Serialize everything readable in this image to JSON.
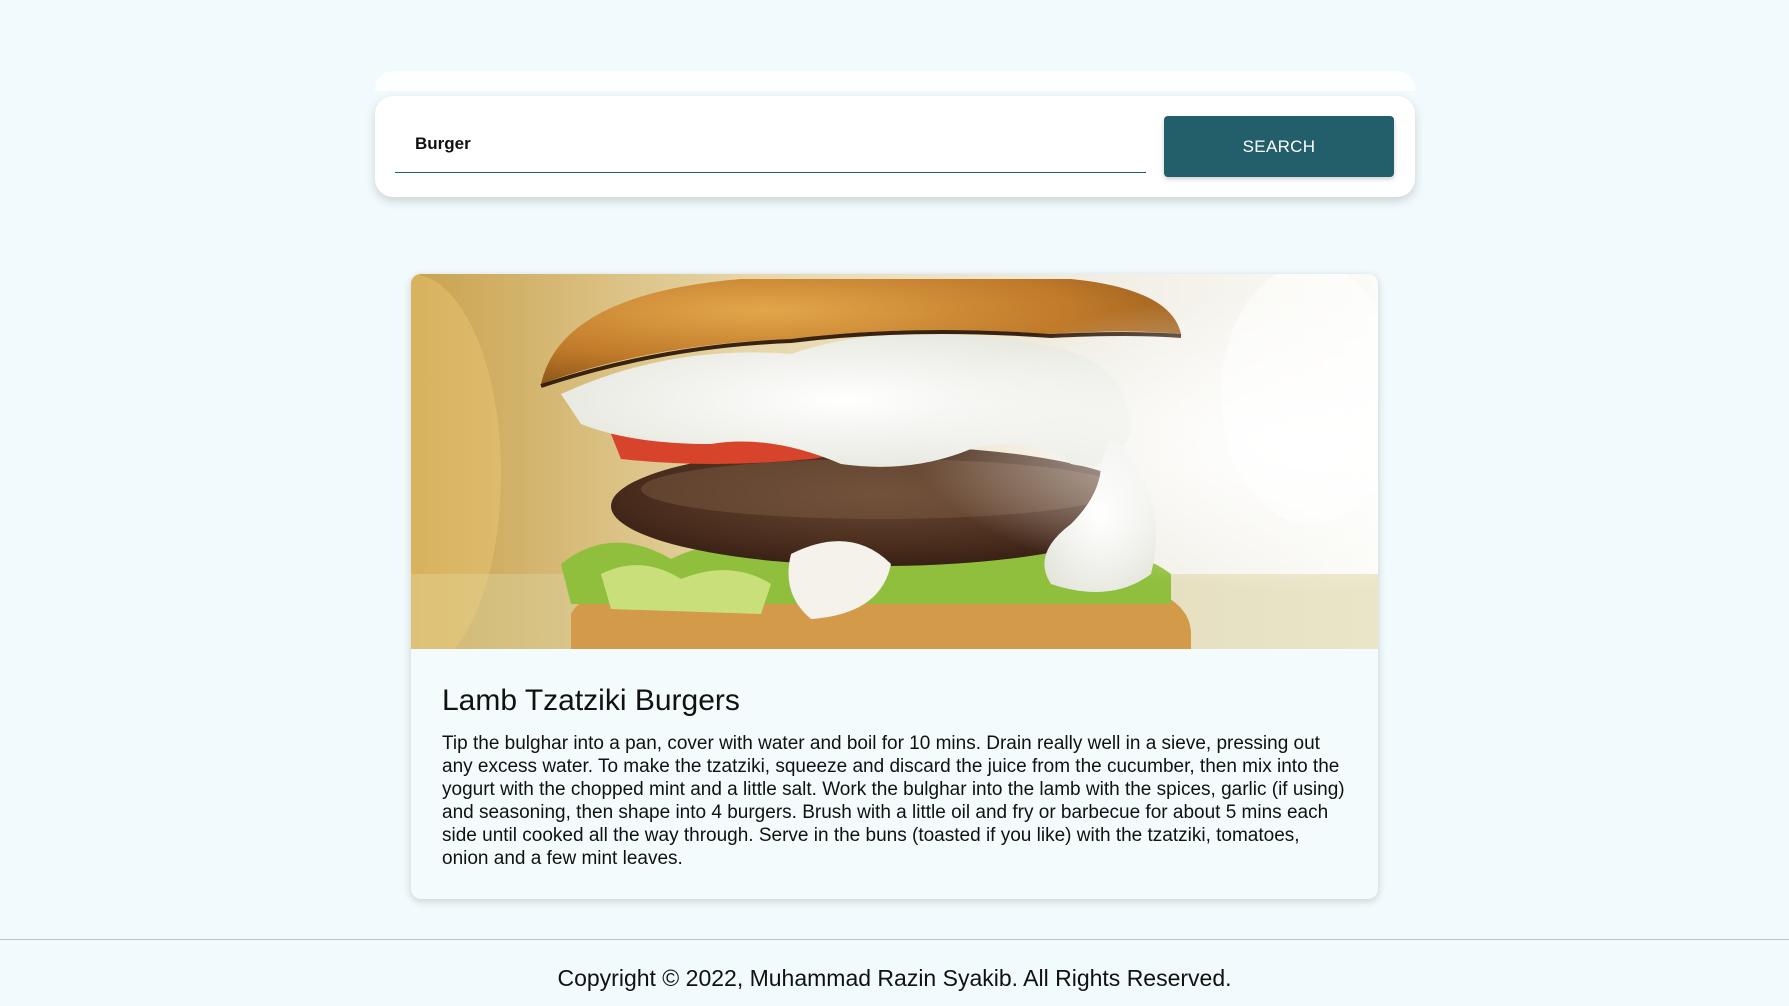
{
  "search": {
    "value": "Burger",
    "button_label": "SEARCH"
  },
  "recipe": {
    "title": "Lamb Tzatziki Burgers",
    "instructions": "Tip the bulghar into a pan, cover with water and boil for 10 mins. Drain really well in a sieve, pressing out any excess water. To make the tzatziki, squeeze and discard the juice from the cucumber, then mix into the yogurt with the chopped mint and a little salt. Work the bulghar into the lamb with the spices, garlic (if using) and seasoning, then shape into 4 burgers. Brush with a little oil and fry or barbecue for about 5 mins each side until cooked all the way through. Serve in the buns (toasted if you like) with the tzatziki, tomatoes, onion and a few mint leaves."
  },
  "footer": {
    "copyright": "Copyright © 2022, Muhammad Razin Syakib. All Rights Reserved."
  },
  "colors": {
    "page_background": "#f1fafc",
    "accent": "#235f6b",
    "card_background": "#f3fbfc"
  }
}
